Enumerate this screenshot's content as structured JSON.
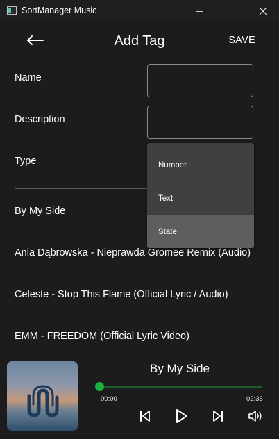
{
  "window": {
    "title": "SortManager Music"
  },
  "header": {
    "title": "Add Tag",
    "save_label": "SAVE"
  },
  "form": {
    "name_label": "Name",
    "name_value": "",
    "description_label": "Description",
    "description_value": "",
    "type_label": "Type"
  },
  "type_dropdown": {
    "options": [
      "Number",
      "Text",
      "State"
    ],
    "highlighted": "State"
  },
  "songs": [
    "By My Side",
    "Ania Dąbrowska - Nieprawda Gromee Remix (Audio)",
    "Celeste - Stop This Flame (Official Lyric / Audio)",
    "EMM - FREEDOM (Official Lyric Video)"
  ],
  "player": {
    "title": "By My Side",
    "elapsed": "00:00",
    "duration": "02:35",
    "progress": 0,
    "accent": "#18b23a"
  },
  "icons": [
    "back-arrow-icon",
    "minimize-icon",
    "maximize-icon",
    "close-icon",
    "skip-previous-icon",
    "play-icon",
    "skip-next-icon",
    "volume-icon"
  ]
}
